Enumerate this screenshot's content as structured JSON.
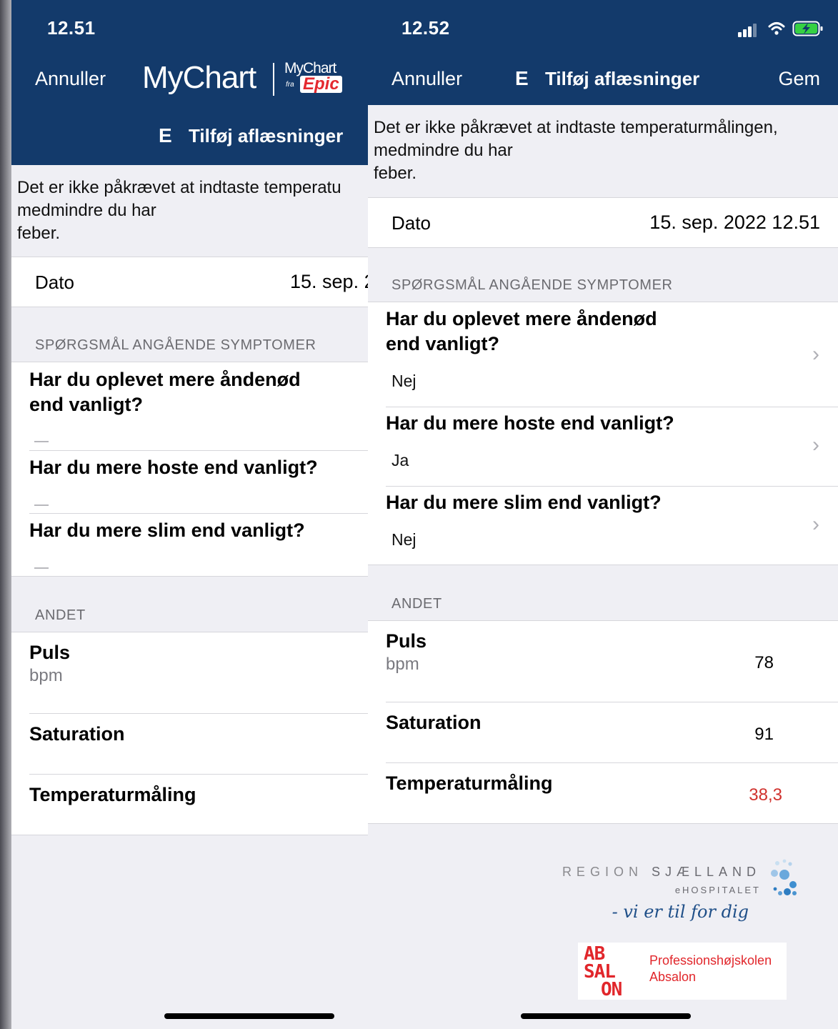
{
  "colors": {
    "nav_bg": "#133a6b",
    "alert_value": "#d0312d",
    "page_bg": "#efeff4"
  },
  "left": {
    "status_time": "12.51",
    "cancel_label": "Annuller",
    "logo_main": "MyChart",
    "logo_small": "MyChart",
    "logo_fra": "fra",
    "logo_epic": "Epic",
    "title_icon": "E",
    "title": "Tilføj aflæsninger",
    "notice_line1": "Det er ikke påkrævet at indtaste temperatu",
    "notice_line2": "medmindre du har",
    "notice_line3": "feber.",
    "date_label": "Dato",
    "date_value": "15. sep. 2",
    "section_symptoms": "SPØRGSMÅL ANGÅENDE SYMPTOMER",
    "q1_line1": "Har du oplevet mere åndenød",
    "q1_line2": "end vanligt?",
    "q2": "Har du mere hoste end vanligt?",
    "q3": "Har du mere slim end vanligt?",
    "section_other": "ANDET",
    "pulse_label": "Puls",
    "pulse_unit": "bpm",
    "saturation_label": "Saturation",
    "temperature_label": "Temperaturmåling"
  },
  "right": {
    "status_time": "12.52",
    "cancel_label": "Annuller",
    "title_icon": "E",
    "title": "Tilføj aflæsninger",
    "save_label": "Gem",
    "notice_line1": "Det er ikke påkrævet at indtaste temperaturmålingen,",
    "notice_line2": "medmindre du har",
    "notice_line3": "feber.",
    "date_label": "Dato",
    "date_value": "15. sep. 2022 12.51",
    "section_symptoms": "SPØRGSMÅL ANGÅENDE SYMPTOMER",
    "q1_line1": "Har du oplevet mere åndenød",
    "q1_line2": "end vanligt?",
    "q1_answer": "Nej",
    "q2": "Har du mere hoste end vanligt?",
    "q2_answer": "Ja",
    "q3": "Har du mere slim end vanligt?",
    "q3_answer": "Nej",
    "section_other": "ANDET",
    "pulse_label": "Puls",
    "pulse_unit": "bpm",
    "pulse_value": "78",
    "saturation_label": "Saturation",
    "saturation_value": "91",
    "temperature_label": "Temperaturmåling",
    "temperature_value": "38,3"
  },
  "branding": {
    "region_word": "REGION",
    "region_name": "SJÆLLAND",
    "region_sub": "eHOSPITALET",
    "region_tagline": "- vi er til for dig",
    "absalon_mark_1": "AB",
    "absalon_mark_2": "SAL",
    "absalon_mark_3": "ON",
    "absalon_line1": "Professionshøjskolen",
    "absalon_line2": "Absalon"
  },
  "icons": [
    "signal-bars-icon",
    "wifi-icon",
    "battery-charging-icon",
    "chevron-right-icon"
  ]
}
